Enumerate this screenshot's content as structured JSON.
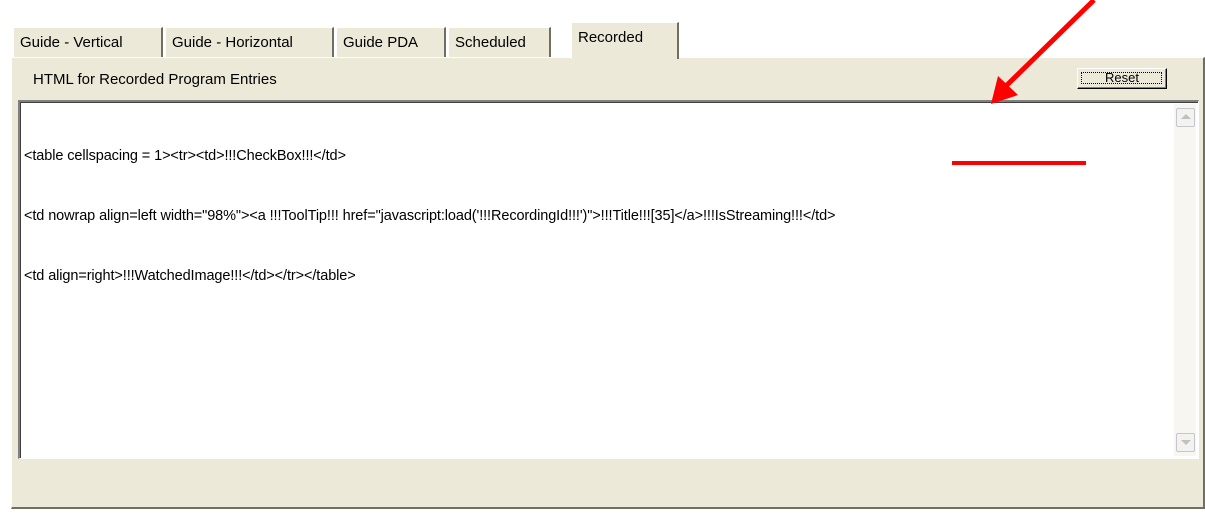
{
  "tabs": [
    {
      "label": "Guide - Vertical"
    },
    {
      "label": "Guide - Horizontal"
    },
    {
      "label": "Guide PDA"
    },
    {
      "label": "Scheduled"
    },
    {
      "label": "Recorded",
      "active": true
    }
  ],
  "panel": {
    "label": "HTML for Recorded Program Entries",
    "reset_label": "Reset"
  },
  "editor": {
    "lines": [
      "<table cellspacing = 1><tr><td>!!!CheckBox!!!</td>",
      "<td nowrap align=left width=\"98%\"><a !!!ToolTip!!! href=\"javascript:load('!!!RecordingId!!!')\">!!!Title!!![35]</a>!!!IsStreaming!!!</td>",
      "<td align=right>!!!WatchedImage!!!</td></tr></table>"
    ]
  },
  "annotation": {
    "highlighted_text": "!!!IsStreaming!!!",
    "color": "#ff0000"
  },
  "icons": [
    "scroll-up-arrow-icon",
    "scroll-down-arrow-icon",
    "red-arrow-annotation-icon"
  ]
}
